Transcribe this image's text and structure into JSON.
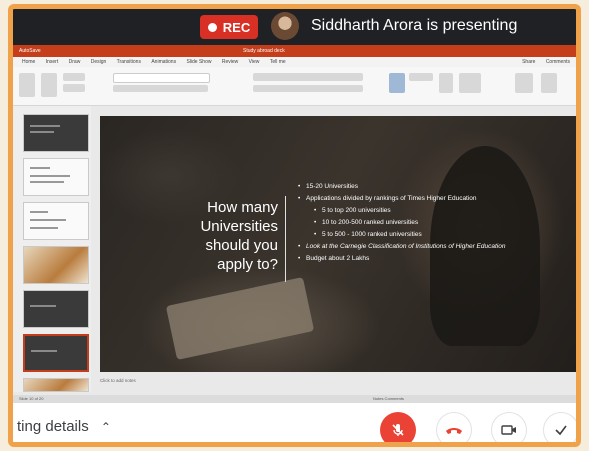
{
  "meet": {
    "rec_label": "REC",
    "presenter_text": "Siddharth Arora is presenting",
    "meeting_details_label": "ting details",
    "meeting_details_chevron": "^",
    "accent": "#f0a24a",
    "rec_color": "#d93025",
    "controls": [
      {
        "name": "mic-off-button",
        "icon": "mic-off-icon",
        "color": "#ea4335"
      },
      {
        "name": "end-call-button",
        "icon": "hangup-icon"
      },
      {
        "name": "camera-button",
        "icon": "camera-icon"
      },
      {
        "name": "more-button",
        "icon": "check-icon"
      }
    ]
  },
  "ppt": {
    "brand_color": "#c43e1c",
    "autosave": "AutoSave",
    "doc_title": "Study abroad deck",
    "menu": [
      "Home",
      "Insert",
      "Draw",
      "Design",
      "Transitions",
      "Animations",
      "Slide Show",
      "Review",
      "View",
      "Tell me"
    ],
    "menu_right": [
      "Share",
      "Comments"
    ],
    "notes_placeholder": "Click to add notes",
    "status_left": "Slide 10 of 20",
    "status_right": "Notes  Comments"
  },
  "slide": {
    "question": [
      "How many",
      "Universities",
      "should you",
      "apply to?"
    ],
    "bullets": [
      {
        "text": "15-20 Universities",
        "level": 0
      },
      {
        "text": "Applications divided by rankings of Times Higher Education",
        "level": 0
      },
      {
        "text": "5 to top 200 universities",
        "level": 1
      },
      {
        "text": "10 to 200-500 ranked universities",
        "level": 1
      },
      {
        "text": "5 to 500 - 1000 ranked universities",
        "level": 1
      },
      {
        "text": "Look at the  Carnegie Classification of Institutions of Higher Education",
        "level": 0
      },
      {
        "text": "Budget about 2 Lakhs",
        "level": 0
      }
    ]
  }
}
